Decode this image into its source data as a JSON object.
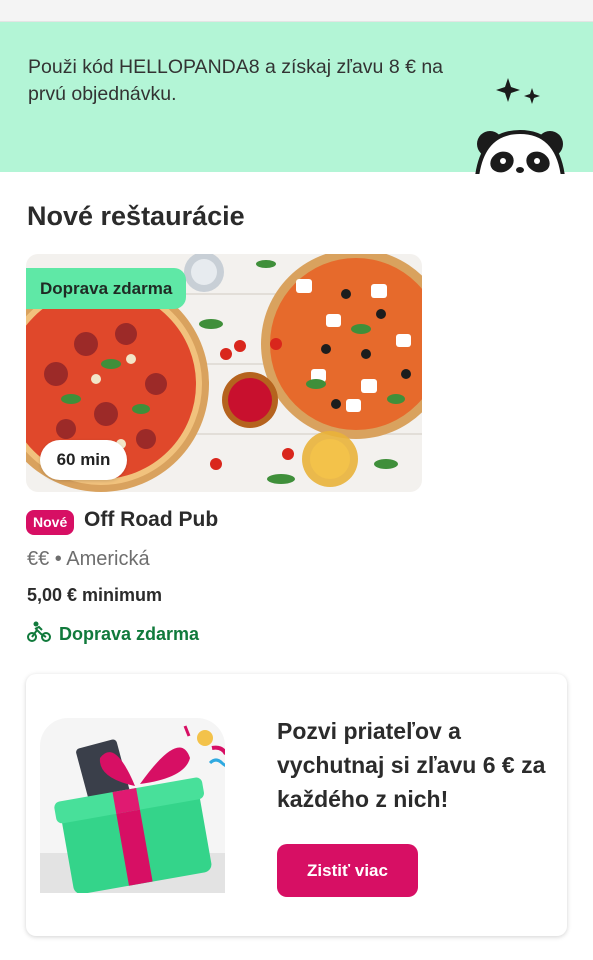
{
  "promo": {
    "text": "Použi kód HELLOPANDA8 a získaj zľavu 8 € na prvú objednávku.",
    "icon": "panda-icon",
    "background": "#b3f5d6"
  },
  "section": {
    "title": "Nové reštaurácie"
  },
  "restaurant": {
    "image_icon": "pizza-photo",
    "free_delivery_badge": "Doprava zdarma",
    "delivery_time": "60 min",
    "new_tag": "Nové",
    "name": "Off Road Pub",
    "price_cuisine": "€€ • Americká",
    "minimum": "5,00 € minimum",
    "delivery_icon": "bike-icon",
    "delivery_text": "Doprava zdarma"
  },
  "invite": {
    "icon": "gift-icon",
    "text": "Pozvi priateľov a vychutnaj si zľavu 6 € za každého z nich!",
    "button_label": "Zistiť viac"
  },
  "colors": {
    "brand": "#d70f64",
    "promo_bg": "#b3f5d6",
    "badge_bg": "#5fe8a6",
    "delivery_green": "#117a3c"
  }
}
